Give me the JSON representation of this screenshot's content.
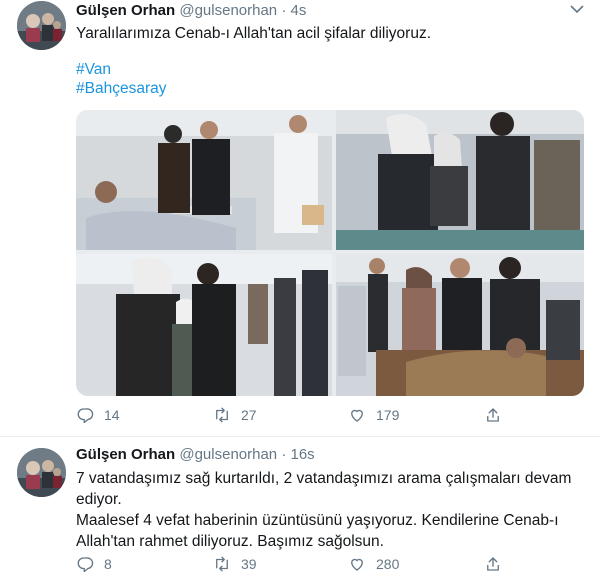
{
  "tweets": [
    {
      "name": "Gülşen Orhan",
      "handle": "@gulsenorhan",
      "separator": "·",
      "time": "4s",
      "text": "Yaralılarımıza Cenab-ı Allah'tan acil şifalar diliyoruz.",
      "hashtags": [
        "#Van",
        "#Bahçesaray"
      ],
      "replies": "14",
      "retweets": "27",
      "likes": "179"
    },
    {
      "name": "Gülşen Orhan",
      "handle": "@gulsenorhan",
      "separator": "·",
      "time": "16s",
      "text_lines": [
        "7 vatandaşımız sağ kurtarıldı, 2 vatandaşımızı arama çalışmaları devam",
        "ediyor.",
        "Maalesef 4 vefat haberinin üzüntüsünü yaşıyoruz. Kendilerine Cenab-ı",
        "Allah'tan rahmet diliyoruz. Başımız sağolsun."
      ],
      "replies": "8",
      "retweets": "39",
      "likes": "280"
    }
  ],
  "colors": {
    "text": "#14171a",
    "secondary": "#657786",
    "link": "#1b95e0",
    "divider": "#e6ecf0"
  },
  "icons": [
    "reply-icon",
    "retweet-icon",
    "like-icon",
    "share-icon",
    "chevron-down-icon"
  ]
}
